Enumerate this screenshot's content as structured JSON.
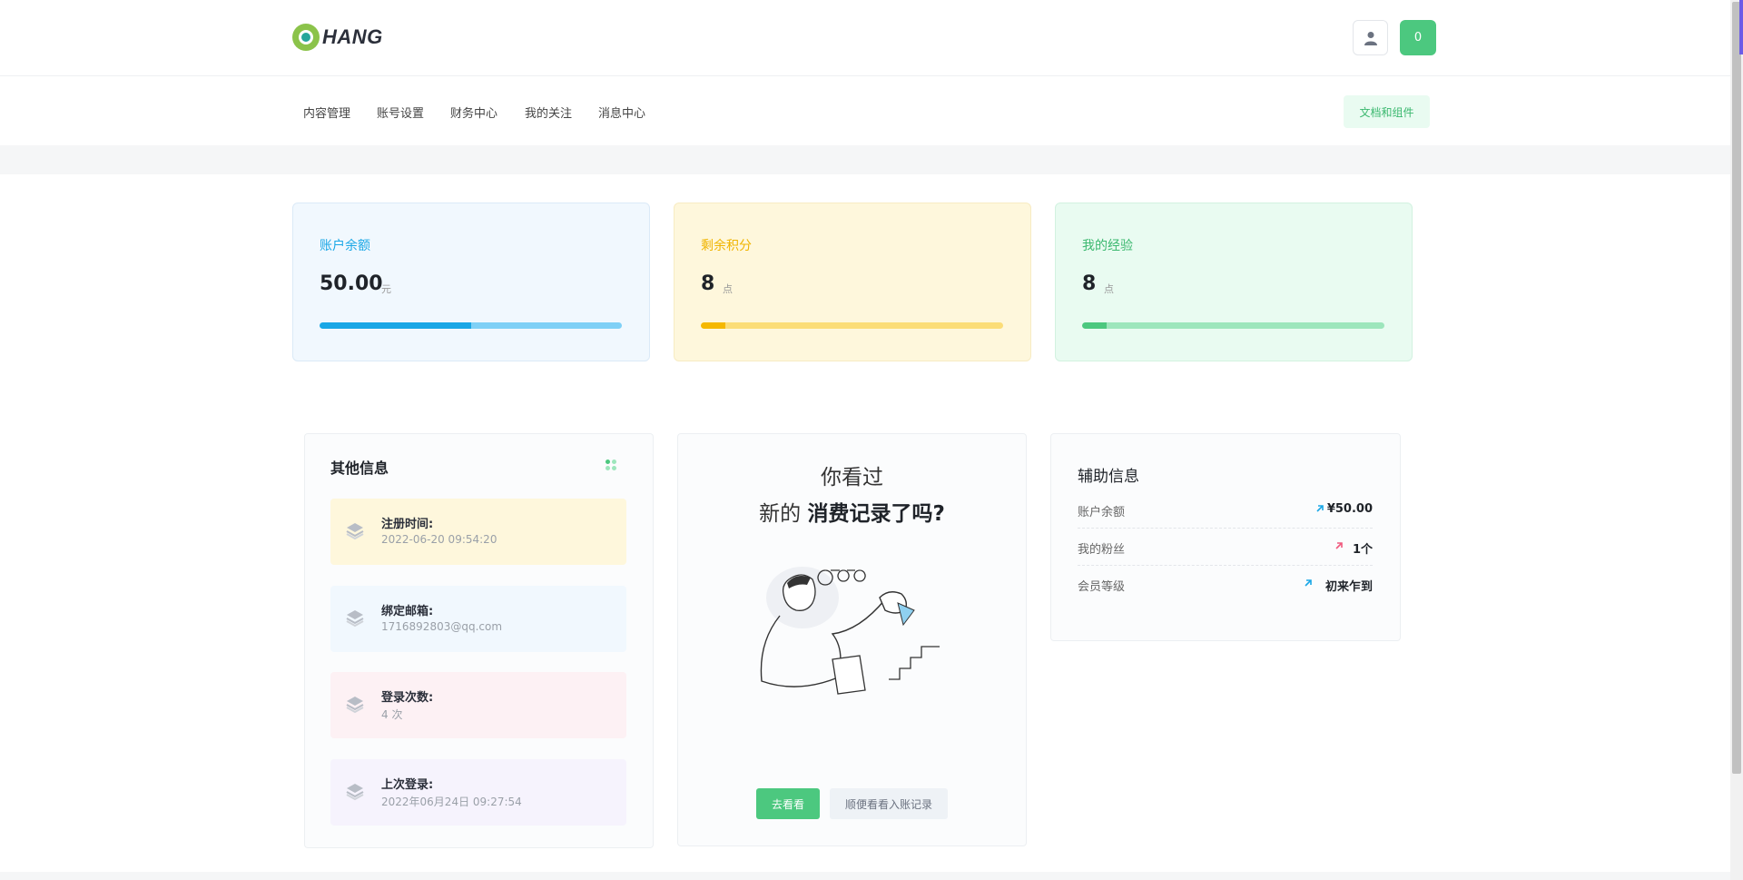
{
  "header": {
    "logo_text": "HANG",
    "cart_count": "0"
  },
  "nav": {
    "items": [
      {
        "label": "内容管理"
      },
      {
        "label": "账号设置"
      },
      {
        "label": "财务中心"
      },
      {
        "label": "我的关注"
      },
      {
        "label": "消息中心"
      }
    ],
    "docs_button": "文档和组件"
  },
  "stats": [
    {
      "label": "账户余额",
      "value": "50.00",
      "unit": "元",
      "progress": 0.5,
      "color": "#1aa7e6"
    },
    {
      "label": "剩余积分",
      "value": "8",
      "unit": "点",
      "progress": 0.08,
      "color": "#f5b800"
    },
    {
      "label": "我的经验",
      "value": "8",
      "unit": "点",
      "progress": 0.08,
      "color": "#4cc87f"
    }
  ],
  "other_info": {
    "title": "其他信息",
    "items": [
      {
        "key": "注册时间:",
        "value": "2022-06-20 09:54:20"
      },
      {
        "key": "绑定邮箱:",
        "value": "1716892803@qq.com"
      },
      {
        "key": "登录次数:",
        "value": "4 次"
      },
      {
        "key": "上次登录:",
        "value": "2022年06月24日 09:27:54"
      }
    ]
  },
  "promo": {
    "line1": "你看过",
    "line2_prefix": "新的 ",
    "line2_bold": "消费记录了吗?",
    "go_button": "去看看",
    "records_button": "顺便看看入账记录"
  },
  "aux_info": {
    "title": "辅助信息",
    "rows": [
      {
        "key": "账户余额",
        "value": "¥50.00",
        "arrow_color": "#1aa7e6"
      },
      {
        "key": "我的粉丝",
        "value": "1个",
        "arrow_color": "#f05a7e"
      },
      {
        "key": "会员等级",
        "value": "初来乍到",
        "arrow_color": "#1aa7e6"
      }
    ]
  }
}
